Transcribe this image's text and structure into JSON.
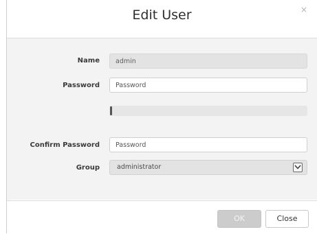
{
  "dialog": {
    "title": "Edit User",
    "close_glyph": "×"
  },
  "form": {
    "name_label": "Name",
    "name_value": "admin",
    "password_label": "Password",
    "password_placeholder": "Password",
    "password_strength_fraction": 0.01,
    "confirm_label": "Confirm Password",
    "confirm_placeholder": "Password",
    "group_label": "Group",
    "group_selected": "administrator"
  },
  "footer": {
    "ok_label": "OK",
    "close_label": "Close"
  },
  "icons": {
    "close": "close-icon",
    "dropdown": "chevron-down-icon"
  },
  "colors": {
    "ok_disabled": "#cccccc",
    "body_bg": "#f3f3f3"
  }
}
